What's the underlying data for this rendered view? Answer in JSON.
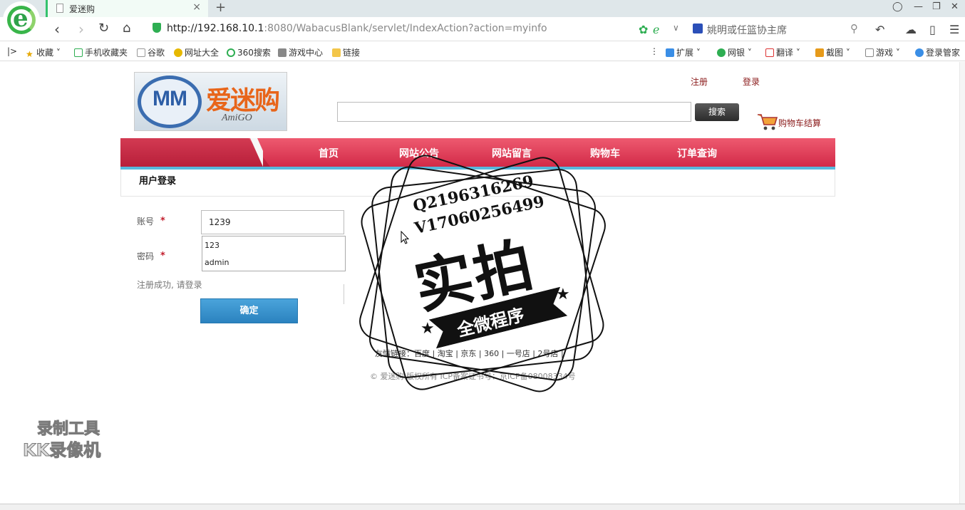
{
  "browser": {
    "tab_title": "爱迷购",
    "tab_close": "×",
    "new_tab": "+",
    "url_host": "http://192.168.10.1",
    "url_rest": ":8080/WabacusBlank/servlet/IndexAction?action=myinfo",
    "search_hint": "姚明或任篮协主席",
    "bookmarks": [
      "收藏",
      "手机收藏夹",
      "谷歌",
      "网址大全",
      "360搜索",
      "游戏中心",
      "链接"
    ],
    "right_tools": [
      "扩展",
      "网银",
      "翻译",
      "截图",
      "游戏",
      "登录管家"
    ]
  },
  "site": {
    "logo_mm": "MM",
    "logo_cn": "爱迷购",
    "logo_en": "AmiGO",
    "register_link": "注册",
    "login_link": "登录",
    "search_button": "搜索",
    "cart_label": "购物车结算",
    "nav": [
      "首页",
      "网站公告",
      "网站留言",
      "购物车",
      "订单查询"
    ]
  },
  "login": {
    "panel_title": "用户登录",
    "account_label": "账号",
    "password_label": "密码",
    "required_mark": "*",
    "account_value": "1239",
    "autocomplete": [
      "123",
      "admin"
    ],
    "message": "注册成功, 请登录",
    "submit_label": "确定"
  },
  "footer": {
    "friend_links": "友情链接：百度 | 淘宝 | 京东 | 360 | 一号店 | 2号店 |",
    "copyright": "© 爱迷购 版权所有 ICP备案证书号：京ICP备08008334号"
  },
  "watermarks": {
    "stamp_line1": "Q2196316269",
    "stamp_line2": "V17060256499",
    "stamp_big": "实拍",
    "stamp_ribbon": "全微程序",
    "recorder_line1": "录制工具",
    "recorder_line2": "KK录像机"
  }
}
